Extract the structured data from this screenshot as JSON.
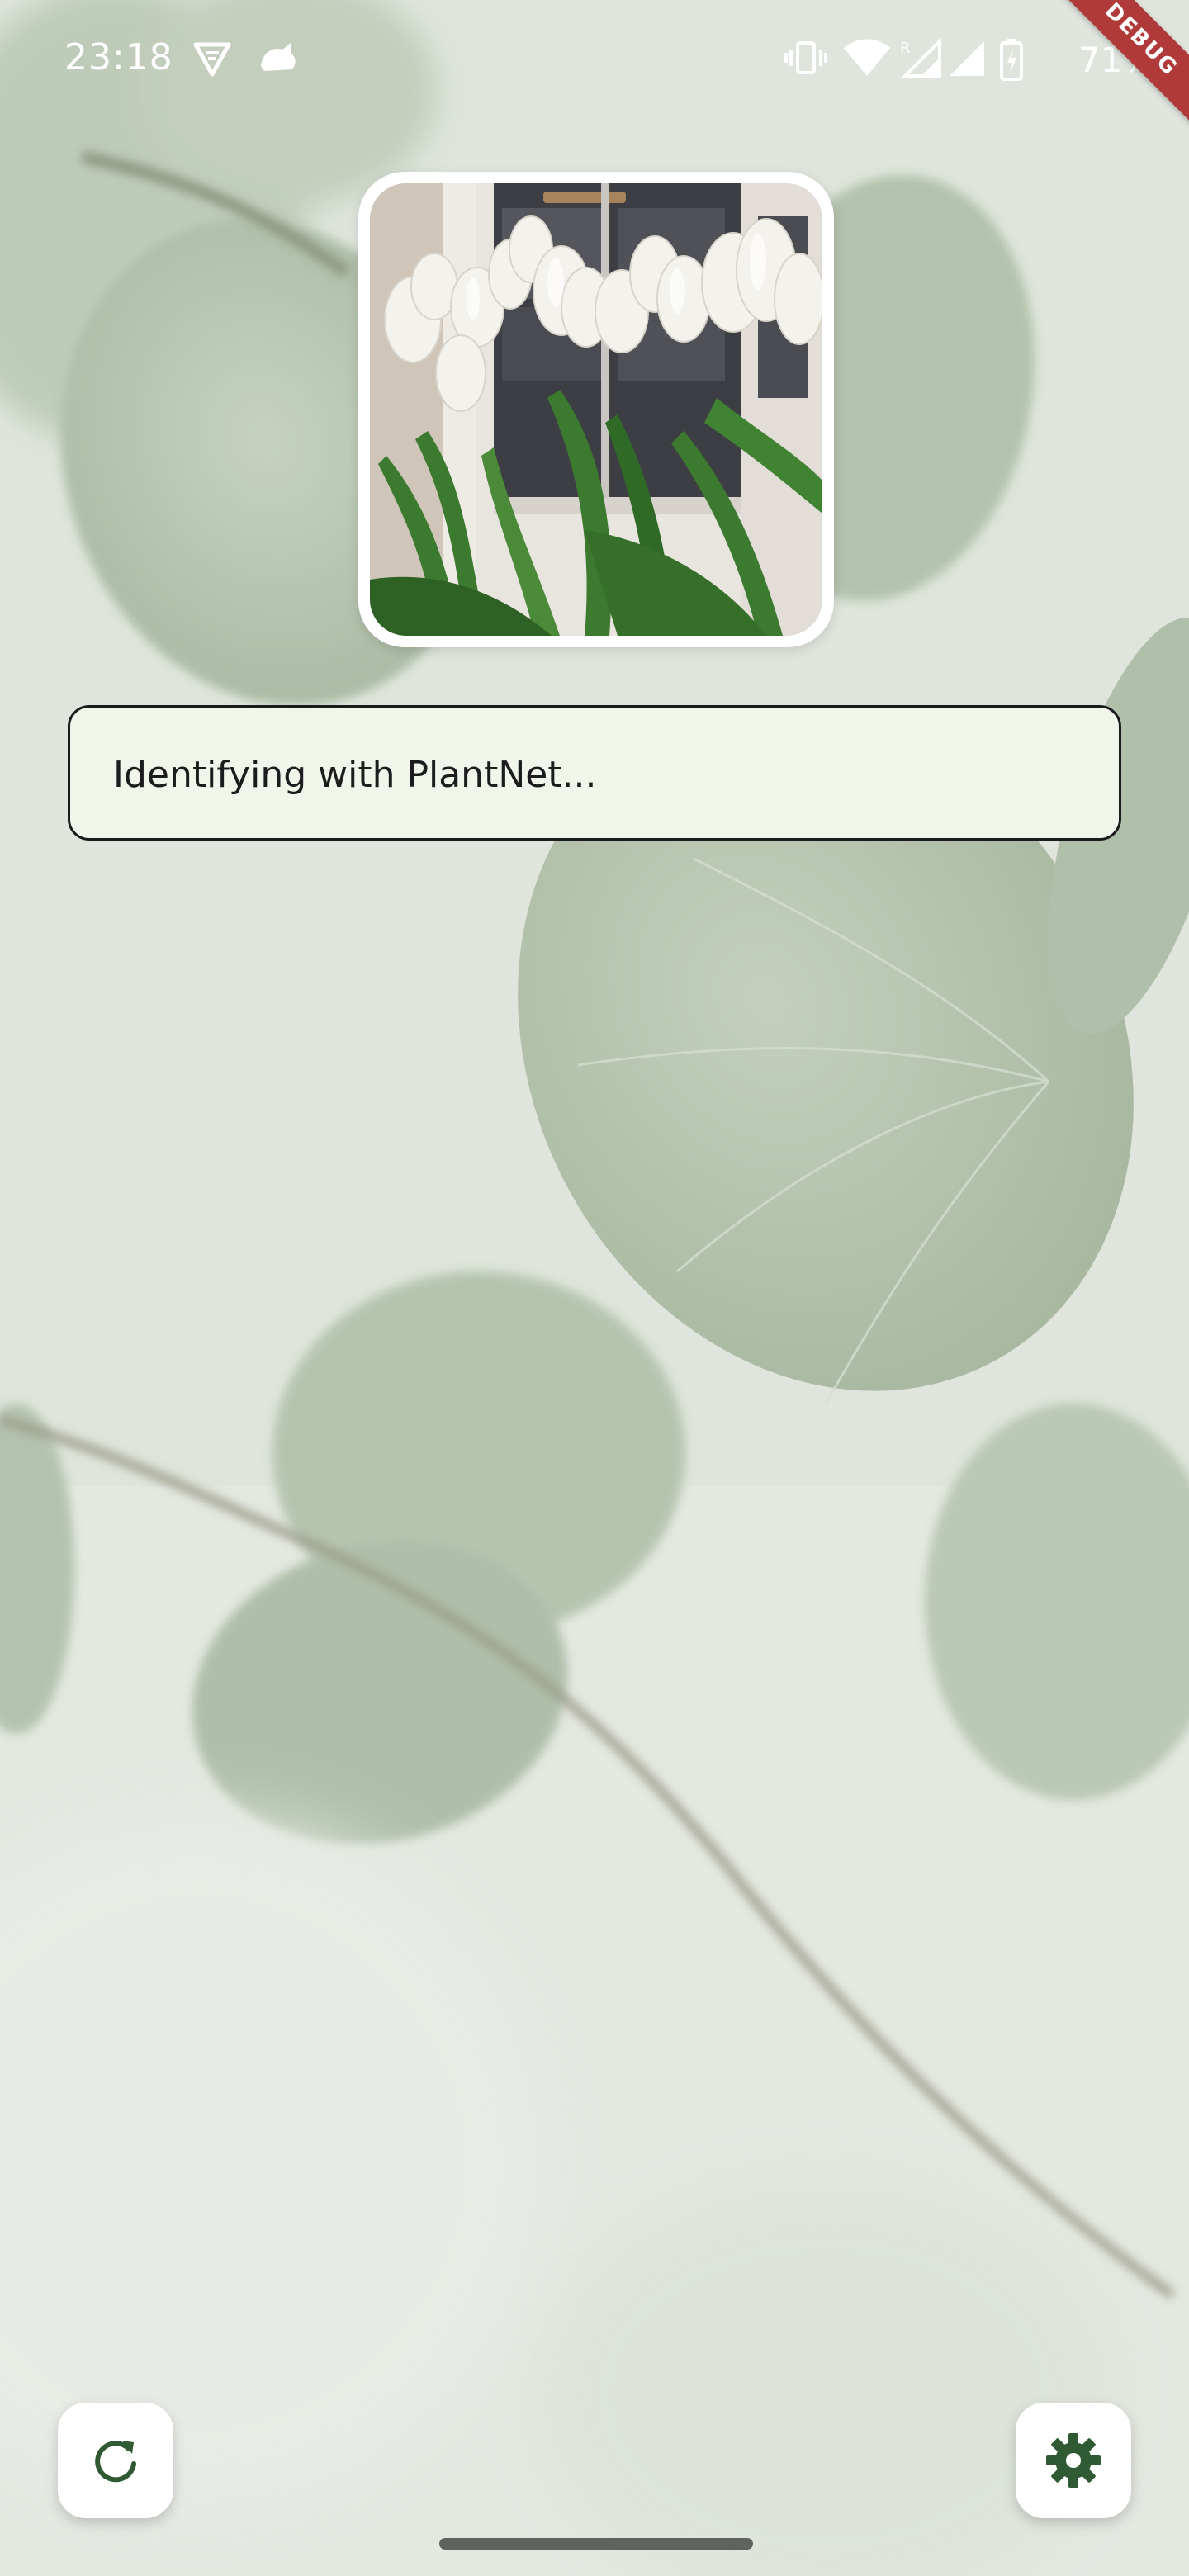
{
  "status_bar": {
    "time": "23:18",
    "battery": "71%",
    "icons": [
      "vpn-shield-icon",
      "notification-bird-icon",
      "vibrate-icon",
      "wifi-icon",
      "signal-icon",
      "battery-icon"
    ]
  },
  "debug_banner": "DEBUG",
  "photo": {
    "subject": "white-tulips-photo"
  },
  "status_message": "Identifying with PlantNet...",
  "actions": {
    "refresh_icon": "refresh-icon",
    "settings_icon": "gear-icon"
  },
  "colors": {
    "accent": "#2f5a33",
    "status_box_bg": "#f1f6ea",
    "debug_banner": "#b03a3a"
  }
}
